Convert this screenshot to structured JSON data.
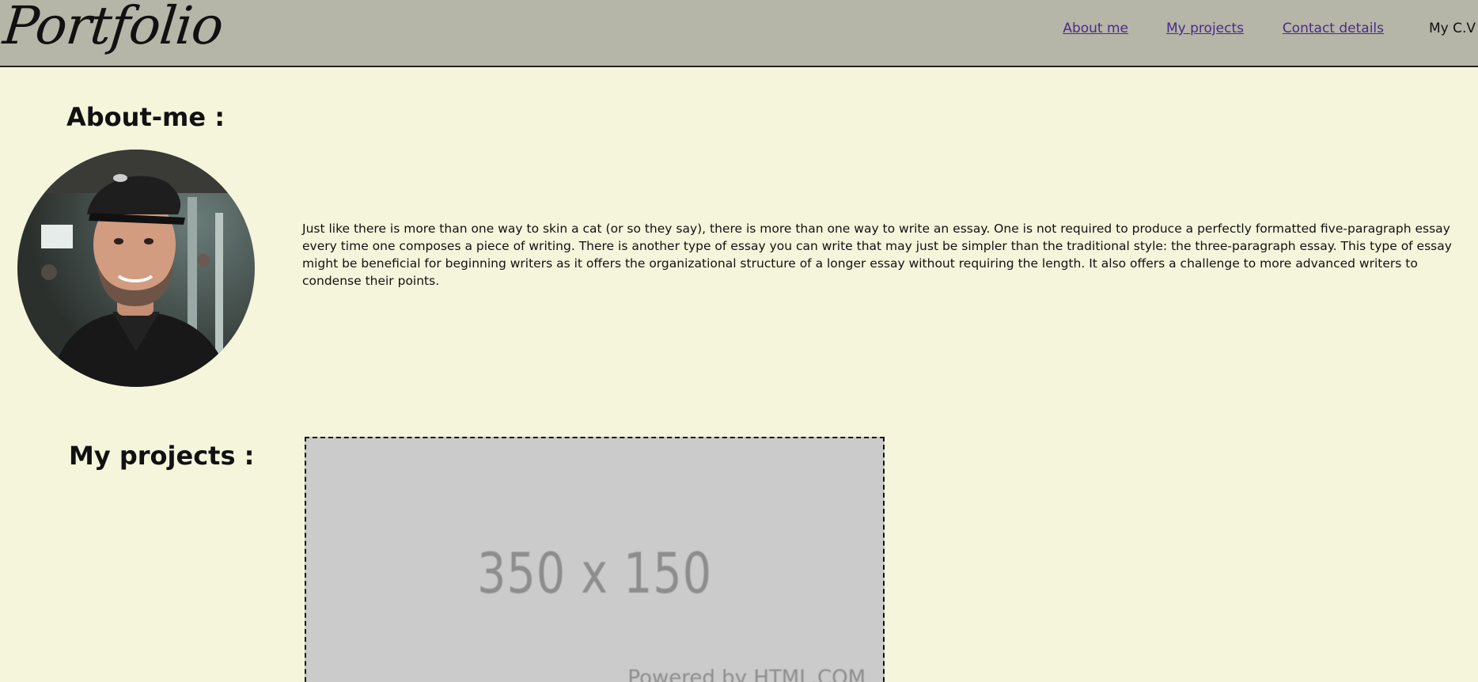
{
  "header": {
    "logo": "Portfolio",
    "nav": {
      "about": "About me ",
      "projects": "My projects",
      "contact": "Contact details",
      "cv": "My C.V"
    }
  },
  "about": {
    "title": "About-me :",
    "text": "Just like there is more than one way to skin a cat (or so they say), there is more than one way to write an essay. One is not required to produce a perfectly formatted five-paragraph essay every time one composes a piece of writing. There is another type of essay you can write that may just be simpler than the traditional style: the three-paragraph essay. This type of essay might be beneficial for beginning writers as it offers the organizational structure of a longer essay without requiring the length. It also offers a challenge to more advanced writers to condense their points."
  },
  "projects": {
    "title": "My projects :",
    "placeholder_size": "350 x 150",
    "placeholder_powered": "Powered by HTML.COM"
  },
  "colors": {
    "page_background": "#f5f5dc",
    "header_background": "#b5b5a8",
    "link": "#4b2b86",
    "placeholder_background": "#cbcbcb",
    "placeholder_text": "#8d8d8d"
  }
}
